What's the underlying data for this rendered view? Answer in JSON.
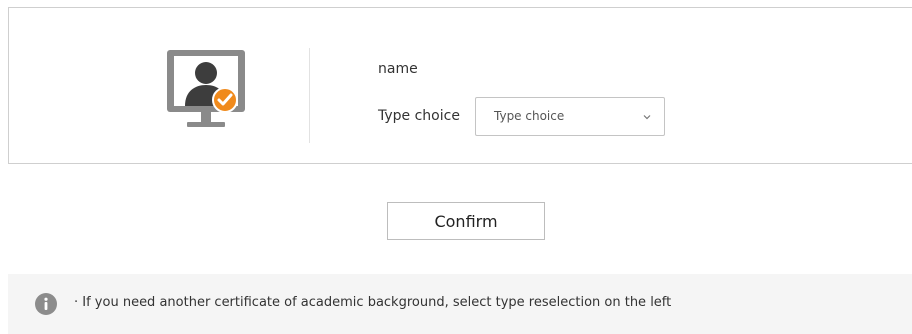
{
  "profile": {
    "name_label": "name",
    "type_label": "Type choice",
    "type_select": {
      "selected": "Type choice",
      "icon": "chevron-down-icon"
    },
    "avatar_icon": "user-verified-monitor-icon",
    "accent_color": "#f08a1c"
  },
  "actions": {
    "confirm_label": "Confirm"
  },
  "notice": {
    "icon": "info-icon",
    "text": "· If you need another certificate of academic background, select type reselection on the left"
  }
}
